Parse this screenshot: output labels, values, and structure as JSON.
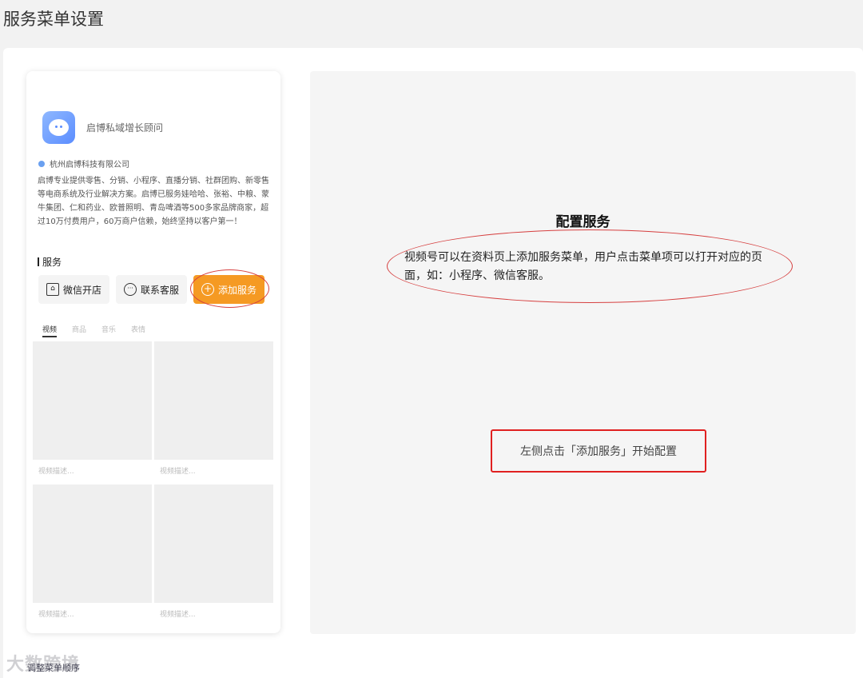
{
  "page": {
    "title": "服务菜单设置"
  },
  "profile": {
    "name": "启博私域增长顾问",
    "company": "杭州启博科技有限公司",
    "description": "启博专业提供零售、分销、小程序、直播分销、社群团购、新零售等电商系统及行业解决方案。启博已服务娃哈哈、张裕、中粮、蒙牛集团、仁和药业、欧普照明、青岛啤酒等500多家品牌商家，超过10万付费用户，60万商户信赖，始终坚持以客户第一！"
  },
  "services": {
    "section_label": "服务",
    "buttons": [
      {
        "label": "微信开店",
        "icon": "store-icon"
      },
      {
        "label": "联系客服",
        "icon": "chat-bubble-icon"
      },
      {
        "label": "添加服务",
        "icon": "plus-circle-icon"
      }
    ]
  },
  "content_tabs": [
    "视频",
    "商品",
    "音乐",
    "表情"
  ],
  "videos": [
    {
      "caption": "视频描述..."
    },
    {
      "caption": "视频描述..."
    },
    {
      "caption": "视频描述..."
    },
    {
      "caption": "视频描述..."
    }
  ],
  "config": {
    "title": "配置服务",
    "description": "视频号可以在资料页上添加服务菜单，用户点击菜单项可以打开对应的页面，如：小程序、微信客服。",
    "hint": "左侧点击「添加服务」开始配置"
  },
  "footer": {
    "link": "调整菜单顺序"
  },
  "watermark": {
    "text": "大数跨境"
  },
  "colors": {
    "accent": "#f59a23",
    "annotation": "#e02020",
    "verified": "#6aa0f0"
  }
}
